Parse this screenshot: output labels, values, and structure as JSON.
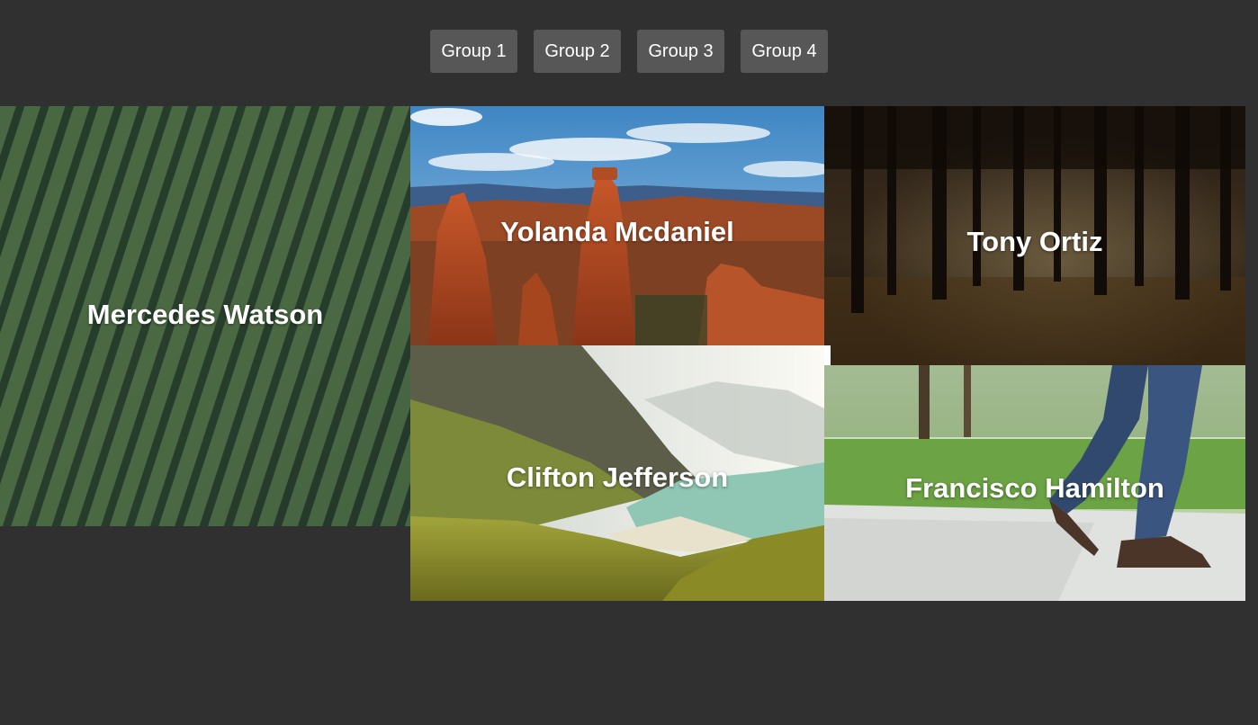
{
  "tabs": [
    {
      "label": "Group 1"
    },
    {
      "label": "Group 2"
    },
    {
      "label": "Group 3"
    },
    {
      "label": "Group 4"
    }
  ],
  "gallery": {
    "items": [
      {
        "name": "Mercedes Watson",
        "image": "tea-field-aerial"
      },
      {
        "name": "Yolanda Mcdaniel",
        "image": "canyon-hoodoos"
      },
      {
        "name": "Tony Ortiz",
        "image": "dark-forest"
      },
      {
        "name": "Clifton Jefferson",
        "image": "mountain-beach"
      },
      {
        "name": "Francisco Hamilton",
        "image": "walking-legs-park"
      }
    ]
  },
  "colors": {
    "background": "#303030",
    "tab_background": "#575757",
    "text": "#ffffff"
  }
}
